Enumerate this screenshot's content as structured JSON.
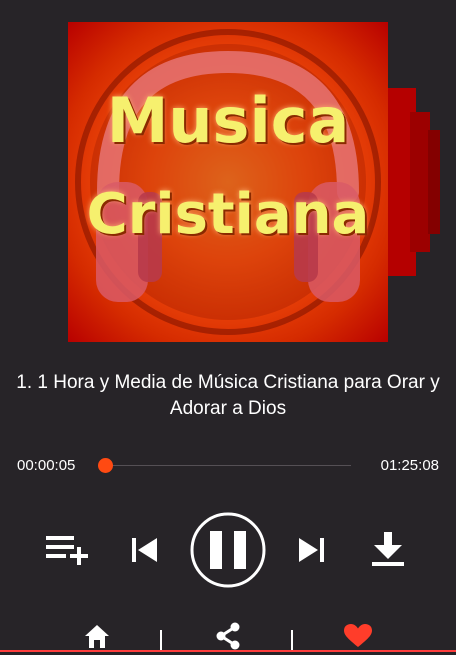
{
  "artwork": {
    "line1": "Musica",
    "line2": "Cristiana",
    "colors": {
      "bg_outer": "#b80000",
      "bg_inner": "#ff5a12",
      "text": "#f6f06e"
    }
  },
  "track": {
    "title": "1. 1 Hora y Media de Música Cristiana para Orar y Adorar a Dios"
  },
  "progress": {
    "elapsed": "00:00:05",
    "total": "01:25:08",
    "fraction": 0.001
  },
  "controls": {
    "add_to_playlist_icon": "playlist-add-icon",
    "previous_icon": "skip-previous-icon",
    "play_pause_icon": "pause-icon",
    "next_icon": "skip-next-icon",
    "download_icon": "download-icon"
  },
  "bottom_nav": {
    "items": [
      "home-icon",
      "share-icon",
      "heart-icon"
    ]
  },
  "theme": {
    "background": "#272428",
    "accent": "#ff4a12",
    "favorite": "#ff3d2a"
  }
}
